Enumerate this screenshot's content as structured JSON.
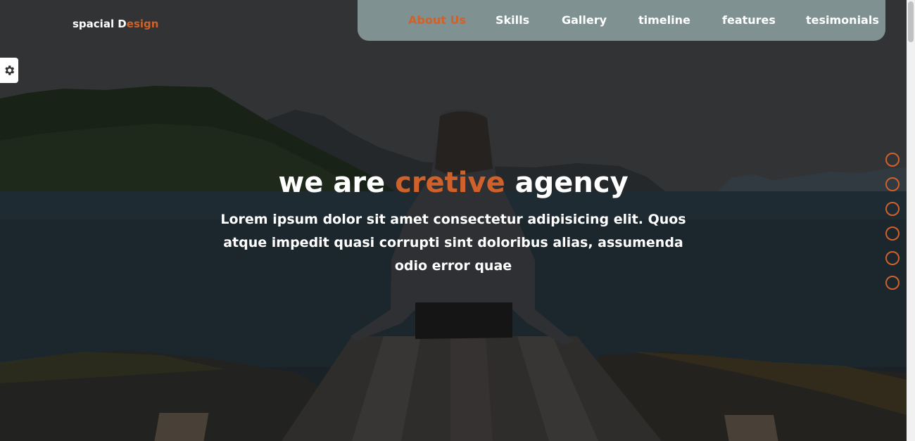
{
  "brand": {
    "prefix": "spacial D",
    "accent": "esign"
  },
  "nav": {
    "items": [
      {
        "label": "About Us",
        "active": true
      },
      {
        "label": "Skills"
      },
      {
        "label": "Gallery"
      },
      {
        "label": "timeline"
      },
      {
        "label": "features"
      },
      {
        "label": "tesimonials"
      }
    ]
  },
  "hero": {
    "headline_part1": "we are ",
    "headline_accent": "cretive",
    "headline_part2": " agency",
    "subtext": "Lorem ipsum dolor sit amet consectetur adipisicing elit. Quos atque impedit quasi corrupti sint doloribus alias, assumenda odio error quae"
  },
  "side_dots": {
    "count": 6
  },
  "icons": {
    "settings": "gear-icon"
  },
  "colors": {
    "accent": "#d0612a",
    "navbar_bg": "#7f9291",
    "text": "#ffffff"
  }
}
